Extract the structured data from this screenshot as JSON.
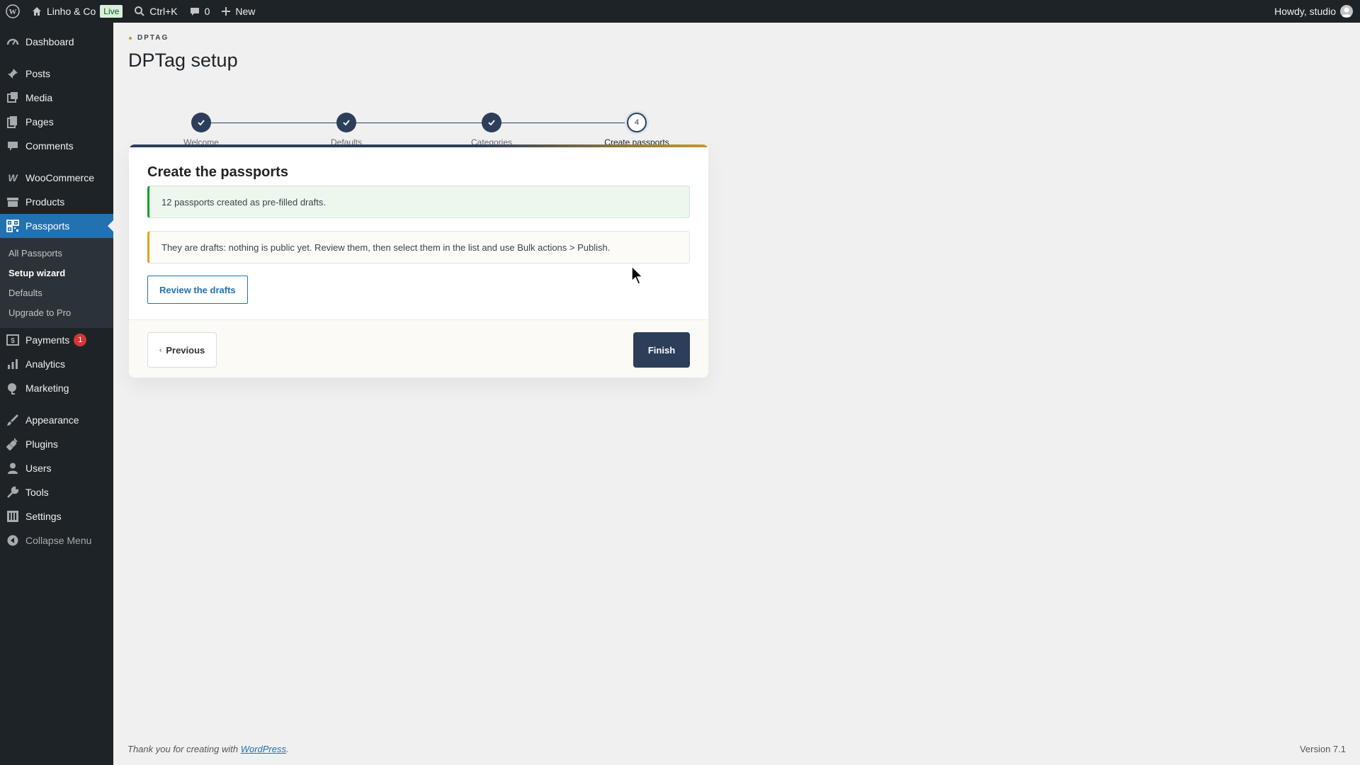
{
  "adminbar": {
    "site_name": "Linho & Co",
    "live_badge": "Live",
    "search_shortcut": "Ctrl+K",
    "comments_count": "0",
    "new_label": "New",
    "howdy": "Howdy, studio"
  },
  "sidebar": {
    "items": [
      {
        "label": "Dashboard",
        "icon": "dashboard-icon"
      },
      {
        "label": "Posts",
        "icon": "pin-icon"
      },
      {
        "label": "Media",
        "icon": "media-icon"
      },
      {
        "label": "Pages",
        "icon": "pages-icon"
      },
      {
        "label": "Comments",
        "icon": "comment-icon"
      },
      {
        "label": "WooCommerce",
        "icon": "woocommerce-icon"
      },
      {
        "label": "Products",
        "icon": "archive-icon"
      },
      {
        "label": "Passports",
        "icon": "qr-grid-icon"
      },
      {
        "label": "Payments",
        "icon": "dollar-icon",
        "badge": "1"
      },
      {
        "label": "Analytics",
        "icon": "bar-chart-icon"
      },
      {
        "label": "Marketing",
        "icon": "megaphone-icon"
      },
      {
        "label": "Appearance",
        "icon": "brush-icon"
      },
      {
        "label": "Plugins",
        "icon": "plug-icon"
      },
      {
        "label": "Users",
        "icon": "user-icon"
      },
      {
        "label": "Tools",
        "icon": "wrench-icon"
      },
      {
        "label": "Settings",
        "icon": "settings-icon"
      },
      {
        "label": "Collapse Menu",
        "icon": "collapse-icon"
      }
    ],
    "submenu": [
      "All Passports",
      "Setup wizard",
      "Defaults",
      "Upgrade to Pro"
    ]
  },
  "page": {
    "eyebrow": "DPTAG",
    "title": "DPTag setup"
  },
  "stepper": {
    "steps": [
      {
        "label": "Welcome",
        "state": "done"
      },
      {
        "label": "Defaults",
        "state": "done"
      },
      {
        "label": "Categories",
        "state": "done"
      },
      {
        "label": "Create passports",
        "state": "active",
        "number": "4"
      }
    ]
  },
  "card": {
    "title": "Create the passports",
    "success_notice": "12 passports created as pre-filled drafts.",
    "warning_notice": "They are drafts: nothing is public yet. Review them, then select them in the list and use Bulk actions > Publish.",
    "review_button": "Review the drafts",
    "previous_button": "Previous",
    "finish_button": "Finish"
  },
  "footer": {
    "thanks_prefix": "Thank you for creating with ",
    "thanks_link": "WordPress",
    "thanks_suffix": ".",
    "version": "Version 7.1"
  },
  "colors": {
    "adminbar_bg": "#1d2327",
    "menu_current": "#2271b1",
    "navy": "#2c3e5a",
    "gold": "#c49a2c",
    "success": "#00a32a",
    "warning": "#dba617",
    "badge": "#d63638"
  }
}
